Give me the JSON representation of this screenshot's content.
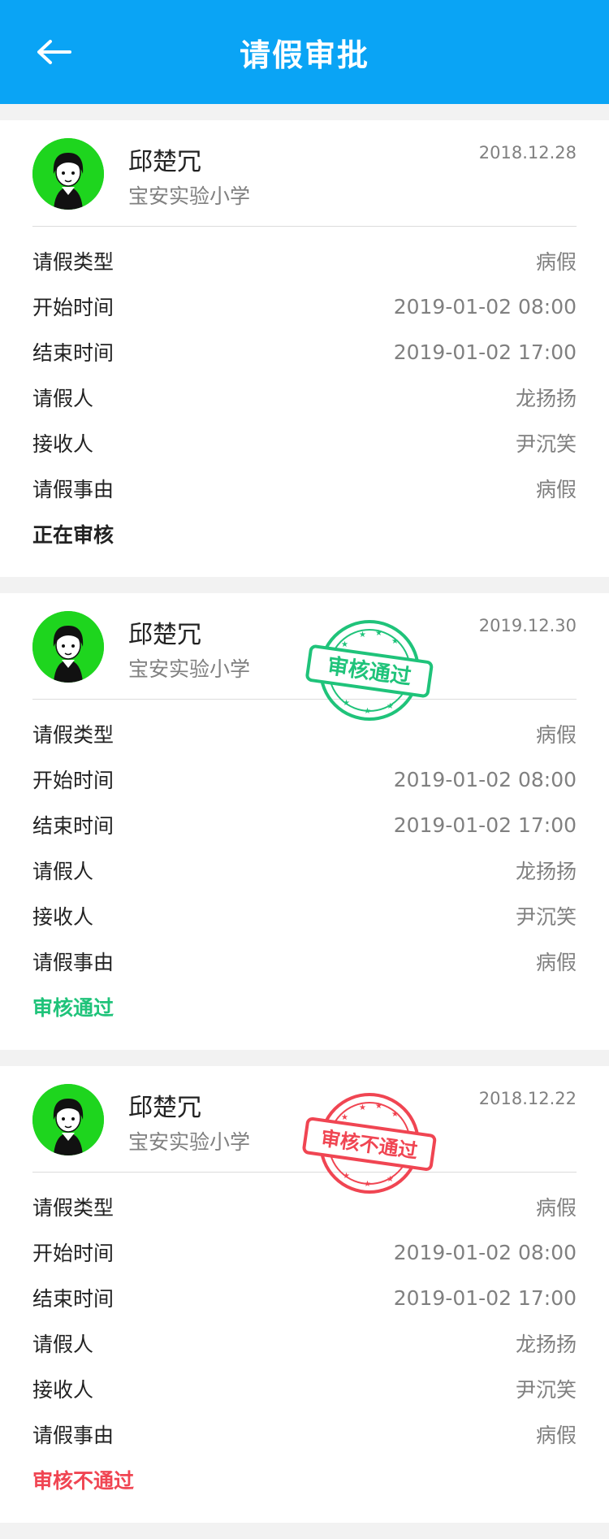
{
  "header": {
    "title": "请假审批",
    "back_icon": "arrow-left-icon"
  },
  "labels": {
    "type": "请假类型",
    "start": "开始时间",
    "end": "结束时间",
    "applicant": "请假人",
    "receiver": "接收人",
    "reason": "请假事由"
  },
  "cards": [
    {
      "name": "邱楚冗",
      "school": "宝安实验小学",
      "date": "2018.12.28",
      "type": "病假",
      "start": "2019-01-02 08:00",
      "end": "2019-01-02 17:00",
      "applicant": "龙扬扬",
      "receiver": "尹沉笑",
      "reason": "病假",
      "status": "正在审核",
      "status_color": "#222222"
    },
    {
      "name": "邱楚冗",
      "school": "宝安实验小学",
      "date": "2019.12.30",
      "type": "病假",
      "start": "2019-01-02 08:00",
      "end": "2019-01-02 17:00",
      "applicant": "龙扬扬",
      "receiver": "尹沉笑",
      "reason": "病假",
      "status": "审核通过",
      "status_color": "#1fc37a",
      "stamp_text": "审核通过"
    },
    {
      "name": "邱楚冗",
      "school": "宝安实验小学",
      "date": "2018.12.22",
      "type": "病假",
      "start": "2019-01-02 08:00",
      "end": "2019-01-02 17:00",
      "applicant": "龙扬扬",
      "receiver": "尹沉笑",
      "reason": "病假",
      "status": "审核不通过",
      "status_color": "#f04552",
      "stamp_text": "审核不通过"
    }
  ],
  "colors": {
    "header_bg": "#0aa4f5",
    "approved": "#1fc37a",
    "rejected": "#f04552"
  }
}
